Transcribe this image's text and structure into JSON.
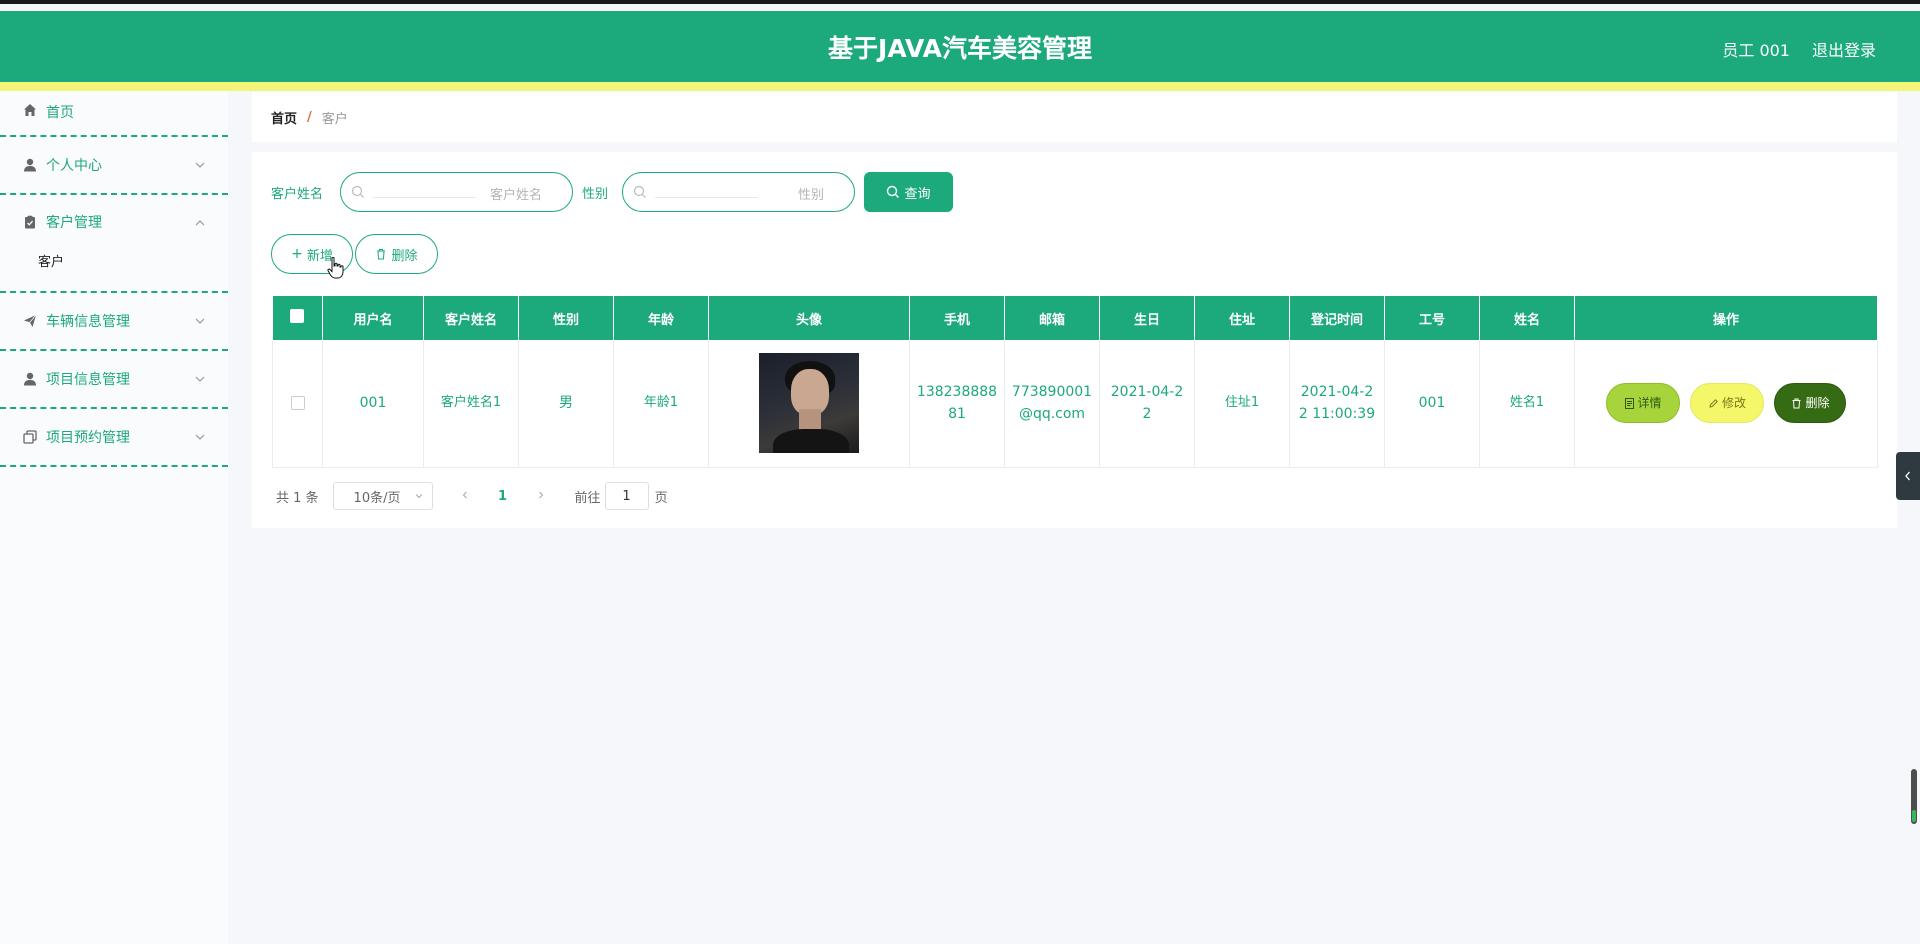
{
  "header": {
    "title": "基于JAVA汽车美容管理",
    "user": "员工 001",
    "logout": "退出登录"
  },
  "sidebar": {
    "items": [
      {
        "label": "首页",
        "icon": "home-icon"
      },
      {
        "label": "个人中心",
        "icon": "user-icon"
      },
      {
        "label": "客户管理",
        "icon": "clipboard-icon"
      },
      {
        "label": "车辆信息管理",
        "icon": "paper-plane-icon"
      },
      {
        "label": "项目信息管理",
        "icon": "user-icon"
      },
      {
        "label": "项目预约管理",
        "icon": "copy-icon"
      }
    ],
    "submenu": "客户"
  },
  "breadcrumb": {
    "home": "首页",
    "separator": "/",
    "current": "客户"
  },
  "search": {
    "name_label": "客户姓名",
    "name_placeholder": "客户姓名",
    "gender_label": "性别",
    "gender_placeholder": "性别",
    "query_label": "查询"
  },
  "actions": {
    "add_label": "新增",
    "delete_label": "删除"
  },
  "table": {
    "headers": [
      "用户名",
      "客户姓名",
      "性别",
      "年龄",
      "头像",
      "手机",
      "邮箱",
      "生日",
      "住址",
      "登记时间",
      "工号",
      "姓名",
      "操作"
    ],
    "rows": [
      {
        "username": "001",
        "customer_name": "客户姓名1",
        "gender": "男",
        "age": "年龄1",
        "phone_l1": "138238888",
        "phone_l2": "81",
        "email_l1": "773890001",
        "email_l2": "@qq.com",
        "birthday_l1": "2021-04-2",
        "birthday_l2": "2",
        "address": "住址1",
        "reg_time_l1": "2021-04-2",
        "reg_time_l2": "2 11:00:39",
        "staff_id": "001",
        "name": "姓名1",
        "op_detail": "详情",
        "op_edit": "修改",
        "op_delete": "删除"
      }
    ]
  },
  "pager": {
    "total": "共 1 条",
    "page_size": "10条/页",
    "current_page": "1",
    "goto_label": "前往",
    "goto_value": "1",
    "page_suffix": "页"
  },
  "colors": {
    "primary": "#1ca97c",
    "yellow_strip": "#f2f57a",
    "detail_btn": "#a7d43a",
    "edit_btn": "#f4f76a",
    "delete_btn": "#356b12"
  }
}
